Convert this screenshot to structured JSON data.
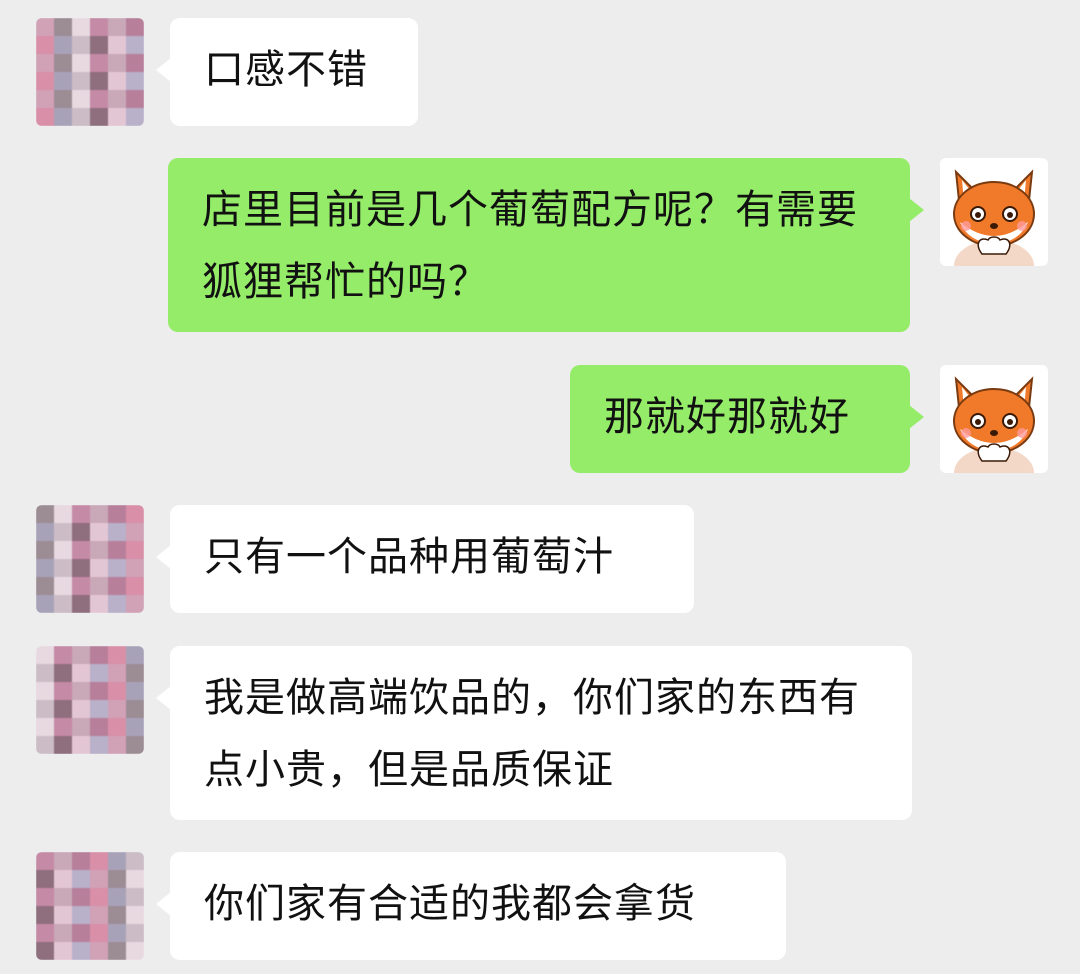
{
  "messages": [
    {
      "side": "in",
      "text": "口感不错",
      "avatar": "pixelated-avatar"
    },
    {
      "side": "out",
      "text": "店里目前是几个葡萄配方呢？有需要狐狸帮忙的吗？",
      "avatar": "fox-avatar"
    },
    {
      "side": "out",
      "text": "那就好那就好",
      "avatar": "fox-avatar"
    },
    {
      "side": "in",
      "text": "只有一个品种用葡萄汁",
      "avatar": "pixelated-avatar"
    },
    {
      "side": "in",
      "text": "我是做高端饮品的，你们家的东西有点小贵，但是品质保证",
      "avatar": "pixelated-avatar"
    },
    {
      "side": "in",
      "text": "你们家有合适的我都会拿货",
      "avatar": "pixelated-avatar"
    }
  ],
  "colors": {
    "background": "#ededed",
    "incoming_bubble": "#ffffff",
    "outgoing_bubble": "#95ec69",
    "fox_orange": "#f07a2a"
  }
}
